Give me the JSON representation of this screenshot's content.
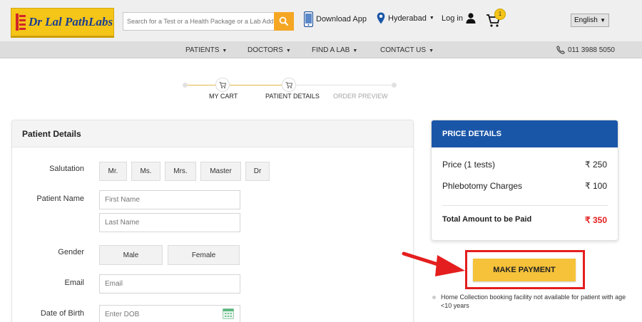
{
  "header": {
    "logo_text": "Dr Lal PathLabs",
    "search_placeholder": "Search for a Test or a Health Package or a Lab Address",
    "download_app": "Download App",
    "city": "Hyderabad",
    "login": "Log in",
    "cart_count": "1",
    "language": "English"
  },
  "nav": {
    "items": [
      "PATIENTS",
      "DOCTORS",
      "FIND A LAB",
      "CONTACT US"
    ],
    "phone": "011 3988 5050"
  },
  "steps": [
    {
      "label": "MY CART",
      "state": "done"
    },
    {
      "label": "PATIENT DETAILS",
      "state": "active"
    },
    {
      "label": "ORDER PREVIEW",
      "state": "pending"
    }
  ],
  "form": {
    "title": "Patient Details",
    "salutation_label": "Salutation",
    "salutations": [
      "Mr.",
      "Ms.",
      "Mrs.",
      "Master",
      "Dr"
    ],
    "name_label": "Patient Name",
    "first_name_placeholder": "First Name",
    "last_name_placeholder": "Last Name",
    "gender_label": "Gender",
    "genders": [
      "Male",
      "Female"
    ],
    "email_label": "Email",
    "email_placeholder": "Email",
    "dob_label": "Date of Birth",
    "dob_placeholder": "Enter DOB"
  },
  "price": {
    "title": "PRICE DETAILS",
    "rows": [
      {
        "label": "Price (1 tests)",
        "value": "₹ 250"
      },
      {
        "label": "Phlebotomy Charges",
        "value": "₹ 100"
      }
    ],
    "total_label": "Total Amount to be Paid",
    "total_value": "₹ 350"
  },
  "payment": {
    "button_label": "MAKE PAYMENT",
    "note": "Home Collection booking facility not available for patient with age <10 years"
  },
  "colors": {
    "brand_yellow": "#f5c518",
    "brand_blue": "#1a56a8",
    "highlight_red": "#e41e1e",
    "total_red": "#e41e1e"
  }
}
